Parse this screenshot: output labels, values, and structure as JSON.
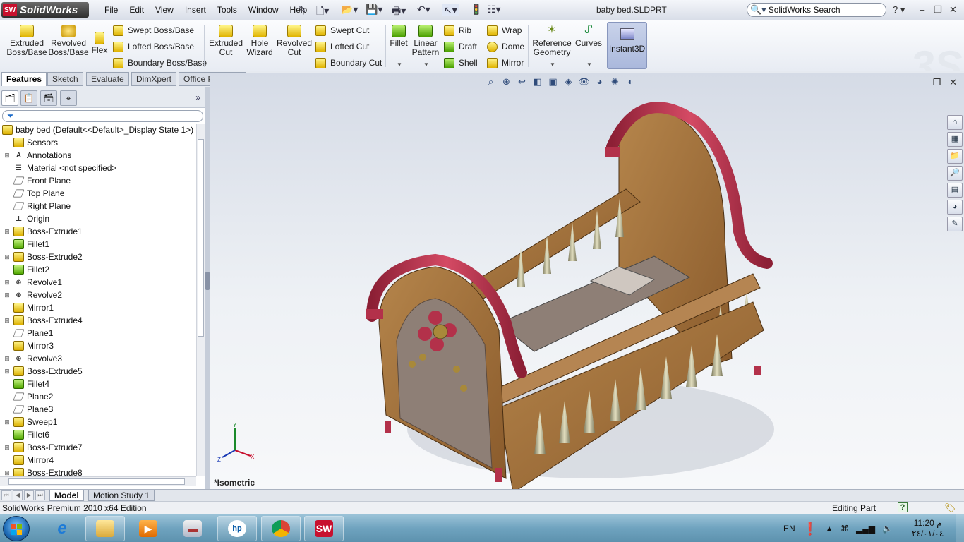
{
  "app": {
    "brand": "SolidWorks",
    "menu": [
      "File",
      "Edit",
      "View",
      "Insert",
      "Tools",
      "Window",
      "Help"
    ],
    "document_title": "baby bed.SLDPRT",
    "search_placeholder": "SolidWorks Search",
    "help_label": "?"
  },
  "command_manager": {
    "extruded_boss": "Extruded Boss/Base",
    "revolved_boss": "Revolved Boss/Base",
    "flex": "Flex",
    "swept_boss": "Swept Boss/Base",
    "lofted_boss": "Lofted Boss/Base",
    "boundary_boss": "Boundary Boss/Base",
    "extruded_cut": "Extruded Cut",
    "hole_wizard": "Hole Wizard",
    "revolved_cut": "Revolved Cut",
    "swept_cut": "Swept Cut",
    "lofted_cut": "Lofted Cut",
    "boundary_cut": "Boundary Cut",
    "fillet": "Fillet",
    "linear_pattern": "Linear Pattern",
    "rib": "Rib",
    "draft": "Draft",
    "shell": "Shell",
    "wrap": "Wrap",
    "dome": "Dome",
    "mirror": "Mirror",
    "reference_geometry": "Reference Geometry",
    "curves": "Curves",
    "instant3d": "Instant3D"
  },
  "cm_tabs": [
    "Features",
    "Sketch",
    "Evaluate",
    "DimXpert",
    "Office Products"
  ],
  "feature_tree": {
    "root": "baby bed  (Default<<Default>_Display State 1>)",
    "items": [
      {
        "label": "Sensors",
        "icon": "sensor-icon",
        "expand": false
      },
      {
        "label": "Annotations",
        "icon": "annotations-icon",
        "expand": true
      },
      {
        "label": "Material <not specified>",
        "icon": "material-icon",
        "expand": false
      },
      {
        "label": "Front Plane",
        "icon": "plane-icon",
        "expand": false
      },
      {
        "label": "Top Plane",
        "icon": "plane-icon",
        "expand": false
      },
      {
        "label": "Right Plane",
        "icon": "plane-icon",
        "expand": false
      },
      {
        "label": "Origin",
        "icon": "origin-icon",
        "expand": false
      },
      {
        "label": "Boss-Extrude1",
        "icon": "extrude-icon",
        "expand": true
      },
      {
        "label": "Fillet1",
        "icon": "fillet-icon",
        "expand": false
      },
      {
        "label": "Boss-Extrude2",
        "icon": "extrude-icon",
        "expand": true
      },
      {
        "label": "Fillet2",
        "icon": "fillet-icon",
        "expand": false
      },
      {
        "label": "Revolve1",
        "icon": "revolve-icon",
        "expand": true
      },
      {
        "label": "Revolve2",
        "icon": "revolve-icon",
        "expand": true
      },
      {
        "label": "Mirror1",
        "icon": "mirror-icon",
        "expand": false
      },
      {
        "label": "Boss-Extrude4",
        "icon": "extrude-icon",
        "expand": true
      },
      {
        "label": "Plane1",
        "icon": "plane-icon",
        "expand": false
      },
      {
        "label": "Mirror3",
        "icon": "mirror-icon",
        "expand": false
      },
      {
        "label": "Revolve3",
        "icon": "revolve-icon",
        "expand": true
      },
      {
        "label": "Boss-Extrude5",
        "icon": "extrude-icon",
        "expand": true
      },
      {
        "label": "Fillet4",
        "icon": "fillet-icon",
        "expand": false
      },
      {
        "label": "Plane2",
        "icon": "plane-icon",
        "expand": false
      },
      {
        "label": "Plane3",
        "icon": "plane-icon",
        "expand": false
      },
      {
        "label": "Sweep1",
        "icon": "sweep-icon",
        "expand": true
      },
      {
        "label": "Fillet6",
        "icon": "fillet-icon",
        "expand": false
      },
      {
        "label": "Boss-Extrude7",
        "icon": "extrude-icon",
        "expand": true
      },
      {
        "label": "Mirror4",
        "icon": "mirror-icon",
        "expand": false
      },
      {
        "label": "Boss-Extrude8",
        "icon": "extrude-icon",
        "expand": true
      }
    ]
  },
  "viewport": {
    "view_name": "*Isometric",
    "model_colors": {
      "wood": "#a0703c",
      "trim": "#b3314a",
      "spindle": "#c8c2a0",
      "panel": "#8e7f76"
    }
  },
  "bottom_tabs": [
    "Model",
    "Motion Study 1"
  ],
  "status": {
    "edition": "SolidWorks Premium 2010 x64 Edition",
    "mode": "Editing Part"
  },
  "taskbar": {
    "language": "EN",
    "time": "11:20 م",
    "date": "٢٤/٠١/٠٤"
  }
}
